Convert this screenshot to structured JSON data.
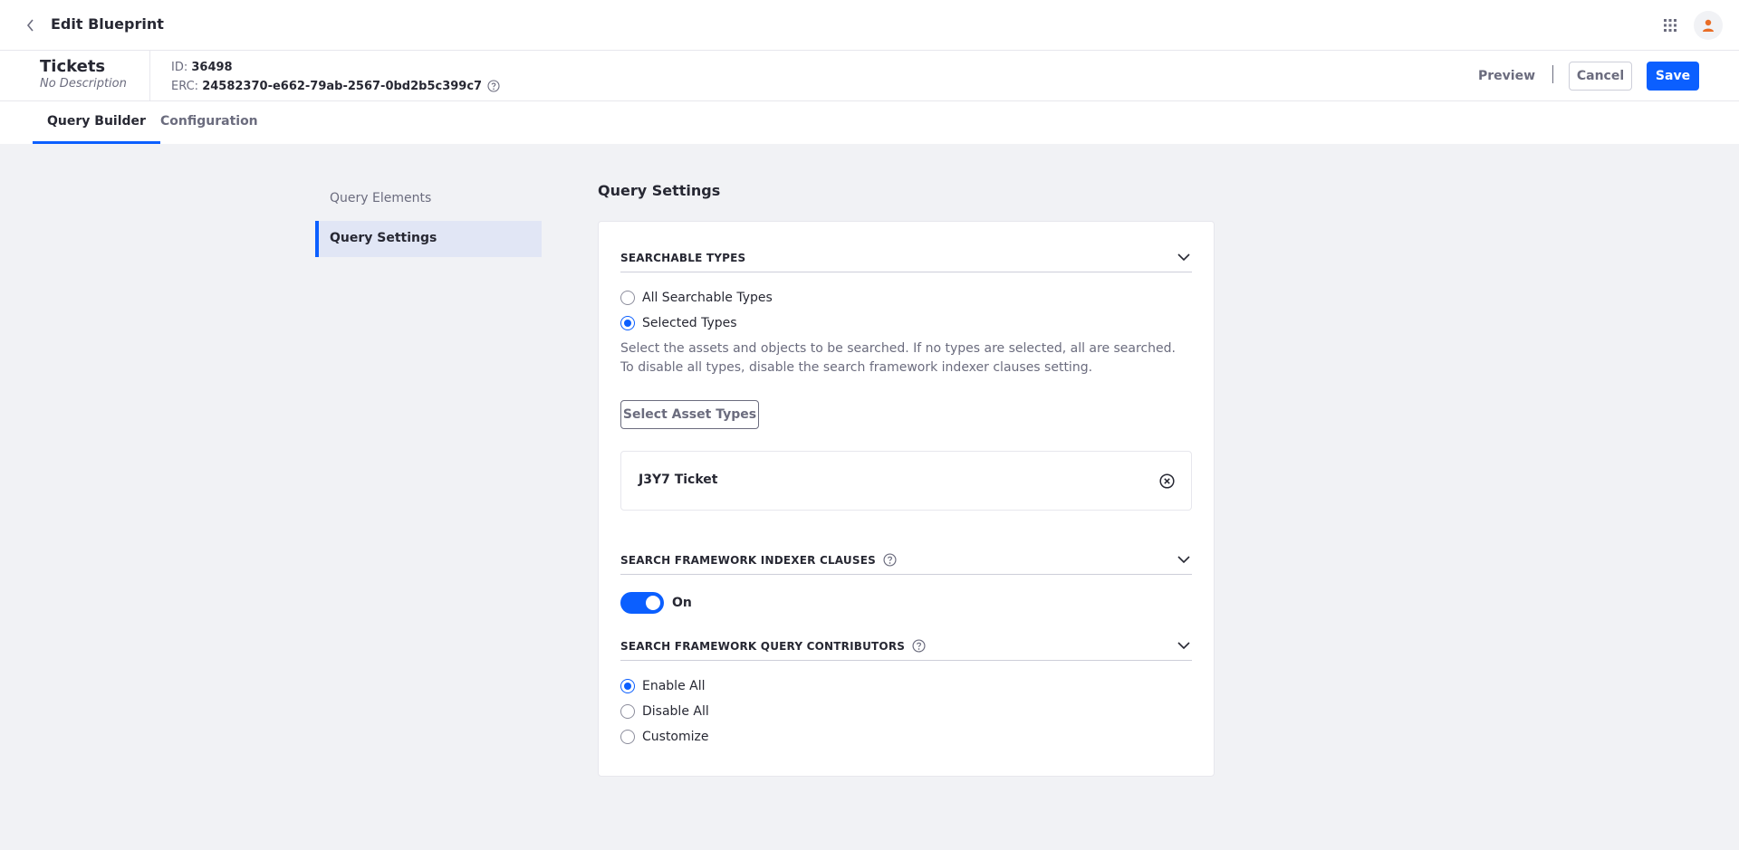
{
  "header": {
    "title": "Edit Blueprint"
  },
  "blueprint": {
    "name": "Tickets",
    "description": "No Description",
    "id_label": "ID:",
    "id_value": "36498",
    "erc_label": "ERC:",
    "erc_value": "24582370-e662-79ab-2567-0bd2b5c399c7"
  },
  "actions": {
    "preview": "Preview",
    "cancel": "Cancel",
    "save": "Save"
  },
  "tabs": [
    {
      "label": "Query Builder",
      "active": true
    },
    {
      "label": "Configuration",
      "active": false
    }
  ],
  "sidenav": {
    "items": [
      {
        "label": "Query Elements",
        "active": false
      },
      {
        "label": "Query Settings",
        "active": true
      }
    ]
  },
  "main": {
    "title": "Query Settings",
    "searchable_types": {
      "title": "SEARCHABLE TYPES",
      "options": [
        {
          "label": "All Searchable Types",
          "checked": false
        },
        {
          "label": "Selected Types",
          "checked": true
        }
      ],
      "help": "Select the assets and objects to be searched. If no types are selected, all are searched. To disable all types, disable the search framework indexer clauses setting.",
      "select_button": "Select Asset Types",
      "selected": [
        "J3Y7 Ticket"
      ]
    },
    "indexer_clauses": {
      "title": "SEARCH FRAMEWORK INDEXER CLAUSES",
      "toggle_label": "On",
      "enabled": true
    },
    "query_contributors": {
      "title": "SEARCH FRAMEWORK QUERY CONTRIBUTORS",
      "options": [
        {
          "label": "Enable All",
          "checked": true
        },
        {
          "label": "Disable All",
          "checked": false
        },
        {
          "label": "Customize",
          "checked": false
        }
      ]
    }
  },
  "colors": {
    "primary": "#0b5fff",
    "text": "#272833",
    "secondary_text": "#6b6c7e",
    "background": "#f1f2f5",
    "nav_active_bg": "#e1e6f5",
    "avatar_icon": "#e96d26"
  },
  "icons": [
    "angle-left-icon",
    "apps-grid-icon",
    "user-icon",
    "question-circle-icon",
    "chevron-down-icon",
    "times-circle-icon"
  ]
}
